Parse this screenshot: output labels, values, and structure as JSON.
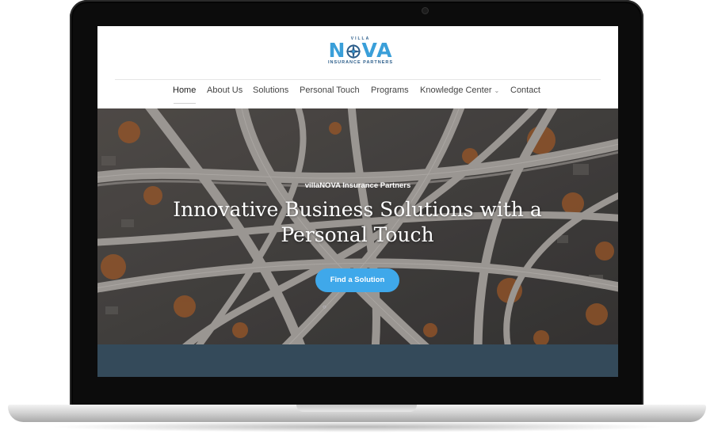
{
  "site": {
    "logo": {
      "small": "VILLA",
      "main_left": "N",
      "main_right": "VA",
      "tagline": "INSURANCE PARTNERS"
    },
    "nav": [
      {
        "label": "Home",
        "active": true
      },
      {
        "label": "About Us"
      },
      {
        "label": "Solutions"
      },
      {
        "label": "Personal Touch"
      },
      {
        "label": "Programs"
      },
      {
        "label": "Knowledge Center",
        "has_dropdown": true
      },
      {
        "label": "Contact"
      }
    ],
    "hero": {
      "eyebrow": "villaNOVA Insurance Partners",
      "title": "Innovative Business Solutions with a Personal Touch",
      "cta": "Find a Solution"
    }
  },
  "colors": {
    "accent": "#3fa8ea",
    "logo_blue": "#3a9fd9",
    "logo_navy": "#2b5d8a",
    "band": "#344a5a"
  },
  "icons": {
    "logo_mark": "compass-star-icon",
    "dropdown": "chevron-down-icon"
  }
}
